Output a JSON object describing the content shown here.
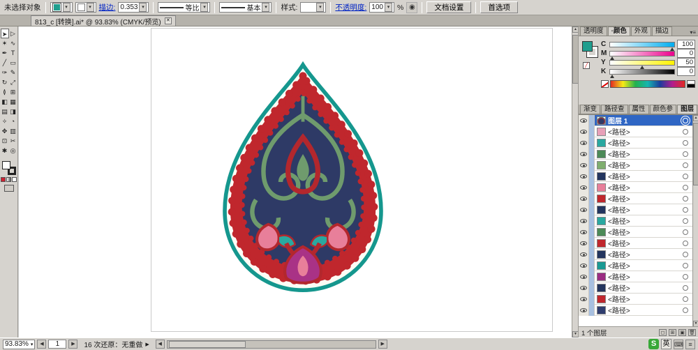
{
  "top_bar": {
    "selection_label": "未选择对象",
    "stroke_label": "描边:",
    "stroke_value": "0.353",
    "uniform_label": "等比",
    "basic_label": "基本",
    "style_label": "样式:",
    "opacity_label": "不透明度:",
    "opacity_value": "100",
    "opacity_unit": "%",
    "doc_setup_button": "文档设置",
    "preferences_button": "首选项"
  },
  "doc_tab": {
    "title": "813_c [转换].ai* @ 93.83% (CMYK/预览)"
  },
  "tools": [
    {
      "name": "selection",
      "glyph": "➤"
    },
    {
      "name": "direct-selection",
      "glyph": "▷"
    },
    {
      "name": "magic-wand",
      "glyph": "✶"
    },
    {
      "name": "lasso",
      "glyph": "∿"
    },
    {
      "name": "pen",
      "glyph": "✒"
    },
    {
      "name": "type",
      "glyph": "T"
    },
    {
      "name": "line",
      "glyph": "╱"
    },
    {
      "name": "rectangle",
      "glyph": "▭"
    },
    {
      "name": "paintbrush",
      "glyph": "✑"
    },
    {
      "name": "pencil",
      "glyph": "✎"
    },
    {
      "name": "rotate",
      "glyph": "↻"
    },
    {
      "name": "scale",
      "glyph": "⤢"
    },
    {
      "name": "width",
      "glyph": "≬"
    },
    {
      "name": "free-transform",
      "glyph": "⊞"
    },
    {
      "name": "shape-builder",
      "glyph": "◧"
    },
    {
      "name": "perspective-grid",
      "glyph": "▦"
    },
    {
      "name": "mesh",
      "glyph": "▤"
    },
    {
      "name": "gradient",
      "glyph": "◨"
    },
    {
      "name": "eyedropper",
      "glyph": "✧"
    },
    {
      "name": "blend",
      "glyph": "◔"
    },
    {
      "name": "symbol-sprayer",
      "glyph": "✥"
    },
    {
      "name": "graph",
      "glyph": "▥"
    },
    {
      "name": "artboard",
      "glyph": "⊡"
    },
    {
      "name": "slice",
      "glyph": "✂"
    },
    {
      "name": "hand",
      "glyph": "✱"
    },
    {
      "name": "zoom",
      "glyph": "◎"
    }
  ],
  "right": {
    "top_tabs": [
      {
        "name": "transparency",
        "label": "透明度",
        "active": false
      },
      {
        "name": "color",
        "label": "◦颜色",
        "active": true
      },
      {
        "name": "appearance",
        "label": "外观",
        "active": false
      },
      {
        "name": "stroke",
        "label": "描边",
        "active": false
      }
    ],
    "color": {
      "channels": [
        {
          "key": "c",
          "label": "C",
          "value": "100",
          "pos": 97
        },
        {
          "key": "m",
          "label": "M",
          "value": "0",
          "pos": 3
        },
        {
          "key": "y",
          "label": "Y",
          "value": "50",
          "pos": 50
        },
        {
          "key": "k",
          "label": "K",
          "value": "0",
          "pos": 3
        }
      ]
    },
    "mid_tabs": [
      {
        "name": "gradient",
        "label": "渐变",
        "active": false
      },
      {
        "name": "pathfinder",
        "label": "路径查",
        "active": false
      },
      {
        "name": "attributes",
        "label": "属性",
        "active": false
      },
      {
        "name": "color-guide",
        "label": "颜色参",
        "active": false
      },
      {
        "name": "layers",
        "label": "图层",
        "active": true
      }
    ],
    "layers": {
      "layer_name": "图层 1",
      "path_label": "<路径>",
      "items": [
        {
          "color": "#e8a0b8"
        },
        {
          "color": "#2aa8a0"
        },
        {
          "color": "#4c8a57"
        },
        {
          "color": "#7fae6e"
        },
        {
          "color": "#23355e"
        },
        {
          "color": "#e87f9a"
        },
        {
          "color": "#c0272d"
        },
        {
          "color": "#23355e"
        },
        {
          "color": "#2aa8a0"
        },
        {
          "color": "#4c8a57"
        },
        {
          "color": "#c0272d"
        },
        {
          "color": "#23355e"
        },
        {
          "color": "#1a9a94"
        },
        {
          "color": "#9b2d83"
        },
        {
          "color": "#23355e"
        },
        {
          "color": "#c0272d"
        },
        {
          "color": "#2f3d6e"
        }
      ]
    }
  },
  "status_bar": {
    "zoom": "93.83%",
    "page": "1",
    "undo_text": "16 次还原：无重做",
    "layers_count": "1 个图层",
    "ime_label": "英",
    "sogou_label": "S",
    "icons": {
      "prev": "◀",
      "next": "▶",
      "up": "▲",
      "down": "▼",
      "menu": "≡",
      "close": "×"
    }
  }
}
